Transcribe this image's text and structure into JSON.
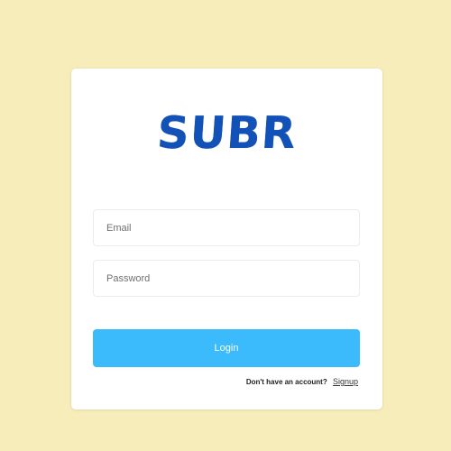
{
  "brand": {
    "logo_text": "SUBR",
    "logo_color": "#1252b8"
  },
  "form": {
    "email_placeholder": "Email",
    "email_value": "",
    "password_placeholder": "Password",
    "password_value": "",
    "login_label": "Login",
    "login_color": "#3bbafc"
  },
  "footer": {
    "question": "Don't have an account?",
    "signup_label": "Signup"
  },
  "theme": {
    "background": "#f6edbb",
    "card": "#ffffff"
  }
}
